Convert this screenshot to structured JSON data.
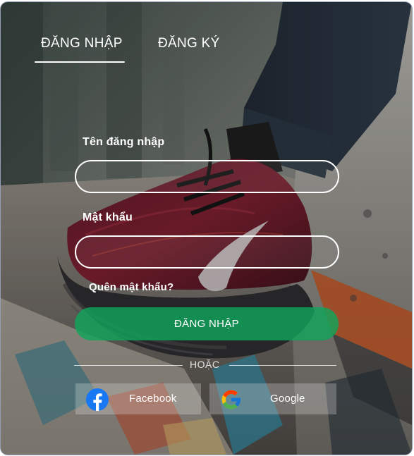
{
  "tabs": {
    "login": "ĐĂNG NHẬP",
    "register": "ĐĂNG KÝ",
    "active": "login"
  },
  "form": {
    "username_label": "Tên đăng nhập",
    "username_value": "",
    "password_label": "Mật khẩu",
    "password_value": "",
    "forgot_link": "Quên mật khẩu?",
    "submit_label": "ĐĂNG NHẬP"
  },
  "divider": {
    "text": "HOẶC"
  },
  "social": {
    "facebook_label": "Facebook",
    "google_label": "Google",
    "facebook_icon": "facebook-icon",
    "google_icon": "google-icon"
  },
  "colors": {
    "primary_button": "#10A55A",
    "facebook": "#1877F2",
    "google_red": "#EA4335",
    "google_yellow": "#FBBC05",
    "google_green": "#34A853",
    "google_blue": "#4285F4"
  }
}
